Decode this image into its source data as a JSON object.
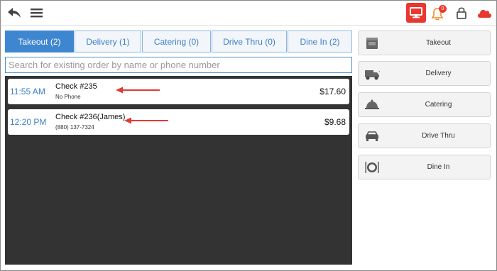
{
  "topbar": {
    "notification_count": "0",
    "accent_color": "#e8382f"
  },
  "tabs": [
    {
      "label": "Takeout (2)",
      "active": true
    },
    {
      "label": "Delivery (1)",
      "active": false
    },
    {
      "label": "Catering (0)",
      "active": false
    },
    {
      "label": "Drive Thru (0)",
      "active": false
    },
    {
      "label": "Dine In (2)",
      "active": false
    }
  ],
  "search": {
    "placeholder": "Search for existing order by name or phone number",
    "value": ""
  },
  "orders": [
    {
      "time": "11:55 AM",
      "check": "Check #235",
      "sub": "No Phone",
      "price": "$17.60"
    },
    {
      "time": "12:20 PM",
      "check": "Check #236(James)",
      "sub": "(880) 137-7324",
      "price": "$9.68"
    }
  ],
  "side_buttons": [
    {
      "label": "Takeout",
      "icon": "takeout-bag-icon"
    },
    {
      "label": "Delivery",
      "icon": "delivery-truck-icon"
    },
    {
      "label": "Catering",
      "icon": "catering-cloche-icon"
    },
    {
      "label": "Drive Thru",
      "icon": "car-icon"
    },
    {
      "label": "Dine In",
      "icon": "plate-cutlery-icon"
    }
  ],
  "colors": {
    "tab_active": "#3f86d0",
    "tab_text": "#3d7fc6",
    "panel_bg": "#333333",
    "arrow": "#e53935"
  }
}
